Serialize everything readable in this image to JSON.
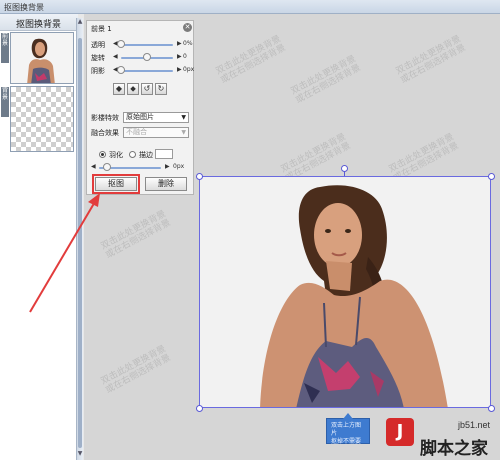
{
  "window": {
    "title": "抠图换背景"
  },
  "left_panel": {
    "header": "抠图换背景",
    "tab_foreground": "前景",
    "tab_background": "背景"
  },
  "layer_panel": {
    "title": "前景 1",
    "close_glyph": "✕",
    "sliders": [
      {
        "label": "透明",
        "value_text": "0%",
        "level": 0.0
      },
      {
        "label": "旋转",
        "value_text": "0",
        "level": 0.5
      },
      {
        "label": "阴影",
        "value_text": "0px",
        "level": 0.0
      }
    ],
    "tools": [
      "flip-horizontal-icon",
      "flip-vertical-icon",
      "rotate-left-icon",
      "rotate-right-icon"
    ],
    "effect_label": "影楼特效",
    "effect_value": "原始图片",
    "blend_label": "融合效果",
    "blend_value": "不融合",
    "feather_label": "羽化",
    "stroke_label": "描边",
    "stroke_value": "",
    "edge_value_text": "0px",
    "cutout_button": "抠图",
    "delete_button": "删除"
  },
  "watermark": {
    "line1": "双击此处更换背景",
    "line2": "或在右侧选择背景"
  },
  "tooltip": {
    "line1": "双击上方图片",
    "line2": "抠掉不需要"
  },
  "brand": {
    "logo": "J",
    "name": "脚本之家",
    "url": "jb51.net"
  },
  "colors": {
    "selection": "#6a6ae0",
    "annotation": "#e23c3c",
    "tooltip": "#3e7bd0"
  }
}
